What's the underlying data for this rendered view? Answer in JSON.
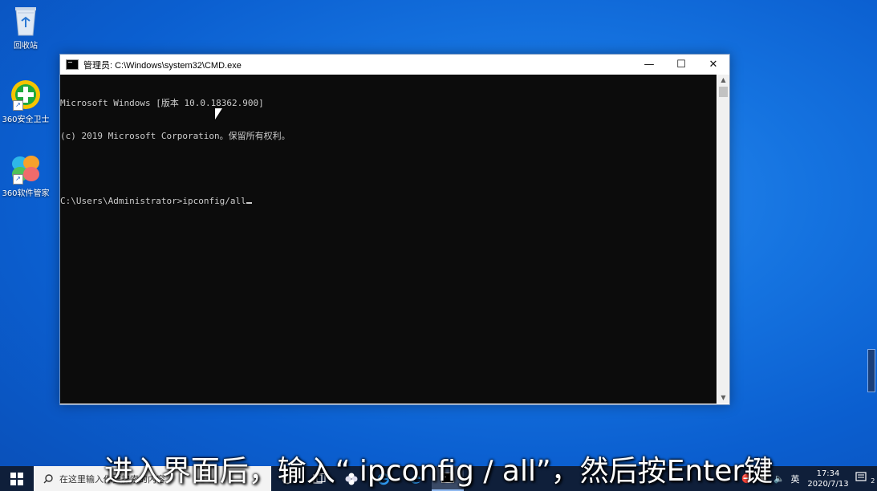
{
  "desktop": {
    "icons": [
      {
        "label": "回收站",
        "icon": "recycle-bin-icon"
      },
      {
        "label": "360安全卫士",
        "icon": "360-security-icon"
      },
      {
        "label": "360软件管家",
        "icon": "360-software-manager-icon"
      }
    ]
  },
  "window": {
    "title": "管理员: C:\\Windows\\system32\\CMD.exe",
    "minimize": "—",
    "maximize": "☐",
    "close": "✕",
    "console": {
      "line1": "Microsoft Windows [版本 10.0.18362.900]",
      "line2": "(c) 2019 Microsoft Corporation。保留所有权利。",
      "line3": "",
      "prompt": "C:\\Users\\Administrator>",
      "command": "ipconfig/all"
    }
  },
  "subtitle": "进入界面后，输入“ ipconfig / all”，然后按Enter键",
  "taskbar": {
    "search_placeholder": "在这里输入你要搜索的内容",
    "tray": {
      "ime": "英",
      "time": "17:34",
      "date": "2020/7/13",
      "notifications": "2"
    }
  },
  "colors": {
    "desktop": "#1573e0",
    "console_bg": "#0c0c0c",
    "console_text": "#cccccc",
    "taskbar": "#0f1f3a"
  }
}
